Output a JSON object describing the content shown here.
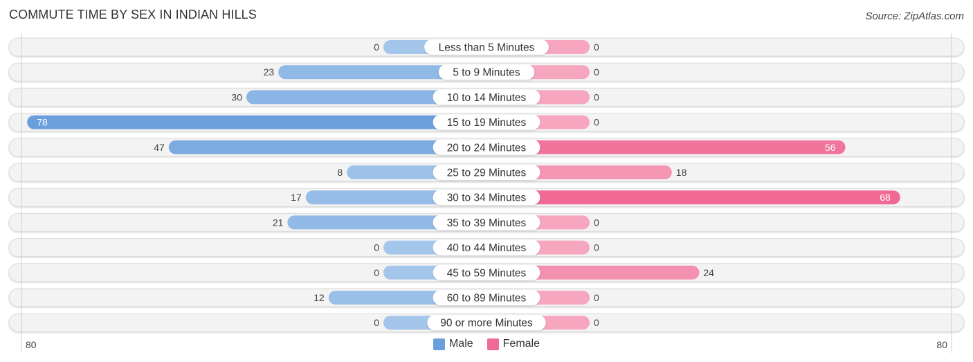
{
  "title": "COMMUTE TIME BY SEX IN INDIAN HILLS",
  "source": "Source: ZipAtlas.com",
  "colors": {
    "male": "#6a9fdc",
    "male_light": "#a8c8ec",
    "female": "#f06a95",
    "female_light": "#f6a9c1",
    "row_bg": "#f3f3f3",
    "row_border": "#dcdcdc"
  },
  "legend": [
    {
      "label": "Male",
      "color": "#6a9fdc"
    },
    {
      "label": "Female",
      "color": "#f06a95"
    }
  ],
  "axis": {
    "left_label": "80",
    "right_label": "80"
  },
  "chart_data": {
    "type": "bar",
    "orientation": "horizontal-diverging",
    "title": "COMMUTE TIME BY SEX IN INDIAN HILLS",
    "categories": [
      "Less than 5 Minutes",
      "5 to 9 Minutes",
      "10 to 14 Minutes",
      "15 to 19 Minutes",
      "20 to 24 Minutes",
      "25 to 29 Minutes",
      "30 to 34 Minutes",
      "35 to 39 Minutes",
      "40 to 44 Minutes",
      "45 to 59 Minutes",
      "60 to 89 Minutes",
      "90 or more Minutes"
    ],
    "series": [
      {
        "name": "Male",
        "values": [
          0,
          23,
          30,
          78,
          47,
          8,
          17,
          21,
          0,
          0,
          12,
          0
        ]
      },
      {
        "name": "Female",
        "values": [
          0,
          0,
          0,
          0,
          56,
          18,
          68,
          0,
          0,
          24,
          0,
          0
        ]
      }
    ],
    "xlim": [
      -80,
      80
    ],
    "tick_labels": [
      "80",
      "80"
    ],
    "legend_position": "bottom-center",
    "grid": false
  }
}
